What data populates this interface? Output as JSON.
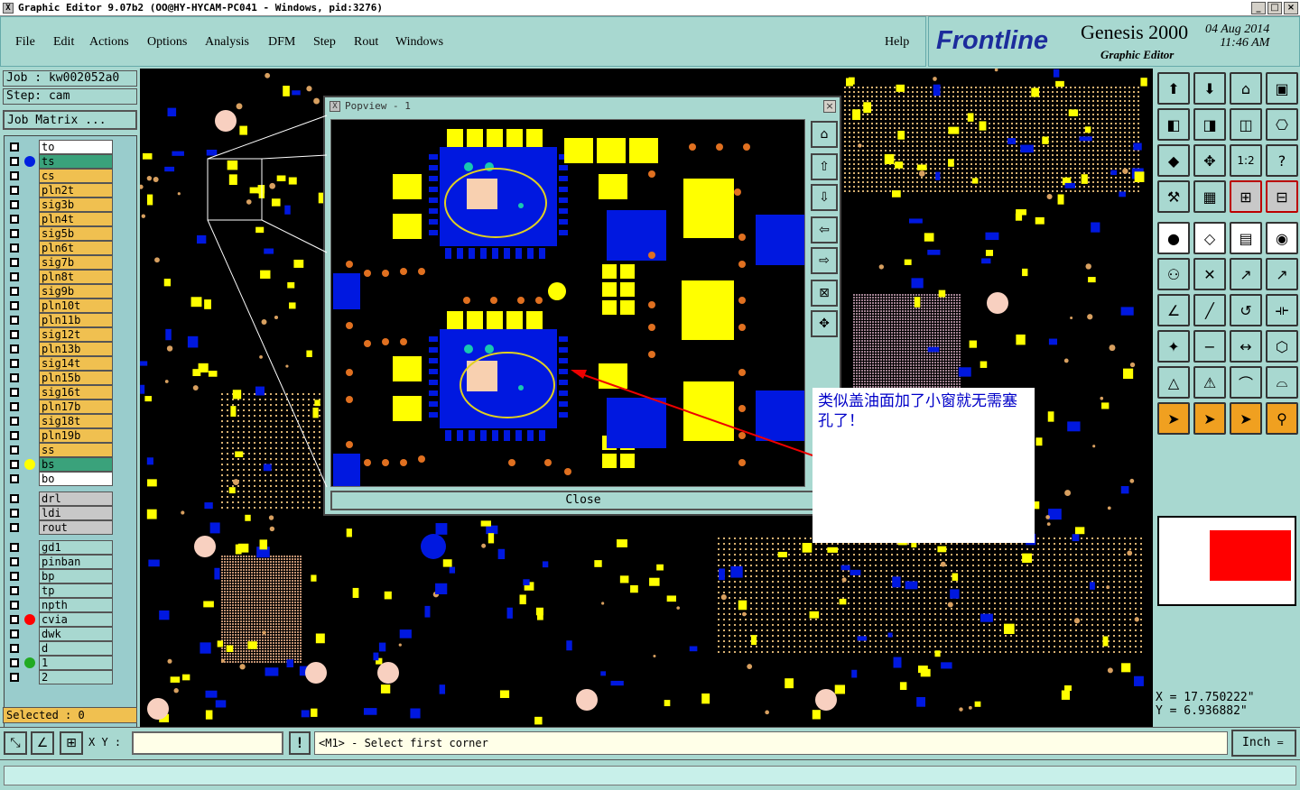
{
  "window": {
    "title": "Graphic Editor 9.07b2 (OO@HY-HYCAM-PC041 - Windows, pid:3276)",
    "close_glyph": "X",
    "minimize_glyph": "_",
    "maximize_glyph": "□",
    "close_btn_glyph": "×"
  },
  "menu": {
    "items": [
      "File",
      "Edit",
      "Actions",
      "Options",
      "Analysis",
      "DFM",
      "Step",
      "Rout",
      "Windows"
    ],
    "help": "Help"
  },
  "brand": {
    "logo": "Frontline",
    "product": "Genesis 2000",
    "subtitle": "Graphic Editor",
    "date": "04 Aug 2014",
    "time": "11:46 AM"
  },
  "job": {
    "job_label": "Job  :  kw002052a0",
    "step_label": "Step:  cam",
    "matrix_button": "Job Matrix ..."
  },
  "layers": {
    "board": [
      "to",
      "ts",
      "cs",
      "pln2t",
      "sig3b",
      "pln4t",
      "sig5b",
      "pln6t",
      "sig7b",
      "pln8t",
      "sig9b",
      "pln10t",
      "pln11b",
      "sig12t",
      "pln13b",
      "sig14t",
      "pln15b",
      "sig16t",
      "pln17b",
      "sig18t",
      "pln19b",
      "ss",
      "bs",
      "bo"
    ],
    "drill": [
      "drl",
      "ldi",
      "rout"
    ],
    "misc": [
      "gd1",
      "pinban",
      "bp",
      "tp",
      "npth",
      "cvia",
      "dwk",
      "d",
      "1",
      "2"
    ]
  },
  "status": {
    "selected": "Selected : 0",
    "xy_label": "X Y :",
    "prompt": "<M1> - Select first corner",
    "units": "Inch",
    "coord_x": "X  =  17.750222\"",
    "coord_y": "Y  =  6.936882\""
  },
  "popview": {
    "title": "Popview - 1",
    "close": "Close"
  },
  "annotation": {
    "text": "类似盖油面加了小窗就无需塞孔了！"
  },
  "colors": {
    "panel": "#a8d8d0",
    "signal_layer": "#f0c050",
    "copper_yellow": "#ffff00",
    "pad_blue": "#0018e0",
    "via_orange": "#e07020",
    "highlight_red": "#ff0000",
    "annotation_text": "#0000c8"
  },
  "icons": {
    "toolbar": [
      "zoom-home-icon",
      "zoom-previous-icon",
      "redraw-icon",
      "split-view-icon",
      "pan-left-icon",
      "pan-right-icon",
      "center-icon",
      "snap-icon",
      "fit-selection-icon",
      "fit-all-icon",
      "one-to-one-icon",
      "query-icon",
      "measure-icon",
      "grid-icon",
      "layer-compare-icon",
      "layer-compare-alt-icon",
      "select-feature-icon",
      "select-area-icon",
      "ruler-icon",
      "highlight-icon",
      "connect-icon",
      "cross-icon",
      "line-icon",
      "arrow-line-icon",
      "angle-icon",
      "slash-icon",
      "rotate-icon",
      "mirror-icon",
      "node-icon",
      "minus-icon",
      "dimension-icon",
      "group-icon",
      "triangle-icon",
      "triangle-alt-icon",
      "arch-icon",
      "arch-alt-icon",
      "pointer-icon",
      "pointer-box-icon",
      "pointer-select-icon",
      "graph-icon"
    ]
  }
}
